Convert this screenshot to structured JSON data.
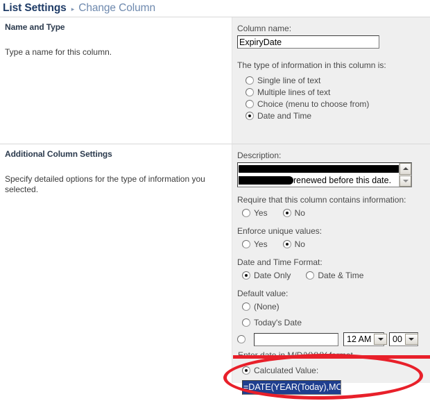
{
  "breadcrumb": {
    "parent": "List Settings",
    "separator_icon": "triangle-right-icon",
    "current": "Change Column"
  },
  "sections": {
    "name_and_type": {
      "title": "Name and Type",
      "description": "Type a name for this column.",
      "column_name_label": "Column name:",
      "column_name_value": "ExpiryDate",
      "type_label": "The type of information in this column is:",
      "type_options": [
        {
          "label": "Single line of text",
          "checked": false
        },
        {
          "label": "Multiple lines of text",
          "checked": false
        },
        {
          "label": "Choice (menu to choose from)",
          "checked": false
        },
        {
          "label": "Date and Time",
          "checked": true
        }
      ]
    },
    "additional_settings": {
      "title": "Additional Column Settings",
      "description": "Specify detailed options for the type of information you selected.",
      "description_label": "Description:",
      "description_value_tail": "renewed before this date.",
      "description_redacted": true,
      "scrollbar_up_icon": "arrow-up-icon",
      "scrollbar_down_icon": "arrow-down-icon",
      "require_label": "Require that this column contains information:",
      "require_options": [
        {
          "label": "Yes",
          "checked": false
        },
        {
          "label": "No",
          "checked": true
        }
      ],
      "unique_label": "Enforce unique values:",
      "unique_options": [
        {
          "label": "Yes",
          "checked": false
        },
        {
          "label": "No",
          "checked": true
        }
      ],
      "format_label": "Date and Time Format:",
      "format_options": [
        {
          "label": "Date Only",
          "checked": true
        },
        {
          "label": "Date & Time",
          "checked": false
        }
      ],
      "default_value_label": "Default value:",
      "default_none_label": "(None)",
      "default_today_label": "Today's Date",
      "default_date_value": "",
      "hour_value": "12 AM",
      "minute_value": "00",
      "dropdown_icon": "chevron-down-icon",
      "date_format_hint": "Enter date in M/D/YYYY format.",
      "calculated_value_label": "Calculated Value:",
      "calculated_value_checked": true,
      "formula_value": "=DATE(YEAR(Today),MO"
    }
  },
  "annotations": {
    "highlight_color": "#e8202a",
    "ellipse_target": "calculated-value-group",
    "underline_target": "default-date-row"
  }
}
